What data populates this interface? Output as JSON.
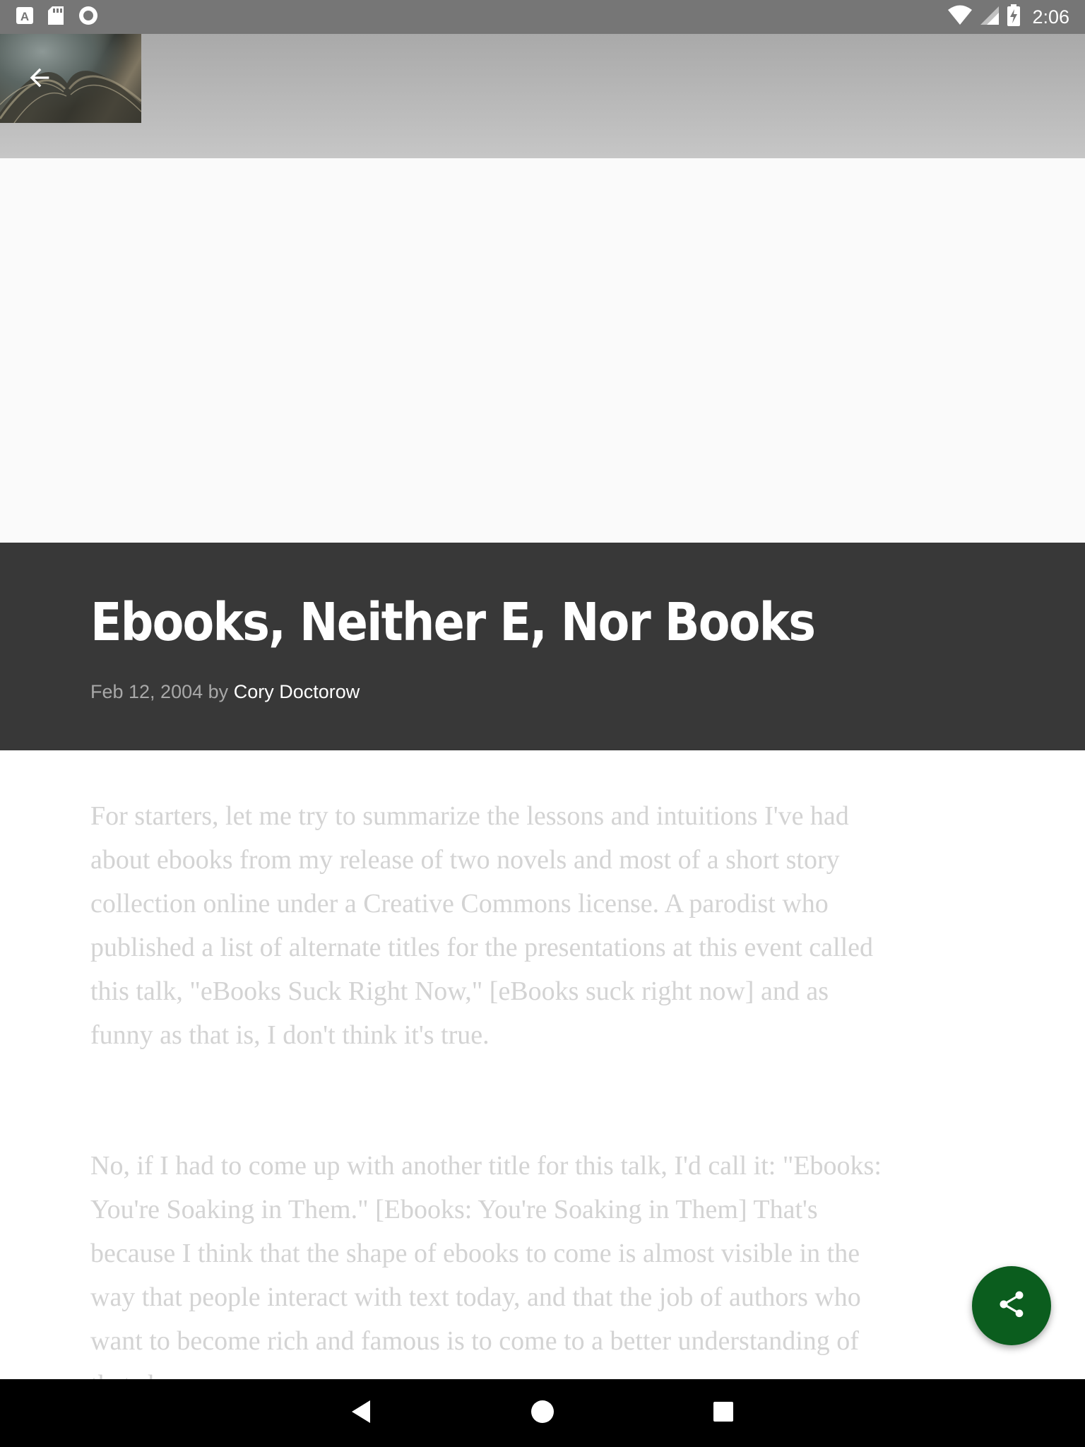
{
  "status_bar": {
    "time": "2:06",
    "left_icons": [
      "font-app-icon",
      "sd-card-icon",
      "record-icon"
    ],
    "right_icons": [
      "wifi-icon",
      "signal-icon",
      "battery-charging-icon"
    ]
  },
  "app_bar": {
    "back_icon": "arrow-back-icon"
  },
  "article": {
    "title": "Ebooks, Neither E, Nor Books",
    "date": "Feb 12, 2004",
    "by": "by",
    "author": "Cory Doctorow",
    "paragraphs": [
      "For starters, let me try to summarize the lessons and intuitions I've had about ebooks from my release of two novels and most of a short story collection online under a Creative Commons license. A parodist who published a list of alternate titles for the presentations at this event called this talk, \"eBooks Suck Right Now,\" [eBooks suck right now] and as funny as that is, I don't think it's true.",
      "No, if I had to come up with another title for this talk, I'd call it: \"Ebooks: You're Soaking in Them.\" [Ebooks: You're Soaking in Them] That's because I think that the shape of ebooks to come is almost visible in the way that people interact with text today, and that the job of authors who want to become rich and famous is to come to a better understanding of that shape."
    ]
  },
  "fab": {
    "icon": "share-icon"
  },
  "nav_bar": {
    "buttons": [
      "back-triangle-icon",
      "home-circle-icon",
      "recents-square-icon"
    ]
  },
  "colors": {
    "fab": "#0b5d1e",
    "title_band": "#383838",
    "status_bar": "#767676",
    "body_text": "#d3d3d3"
  }
}
